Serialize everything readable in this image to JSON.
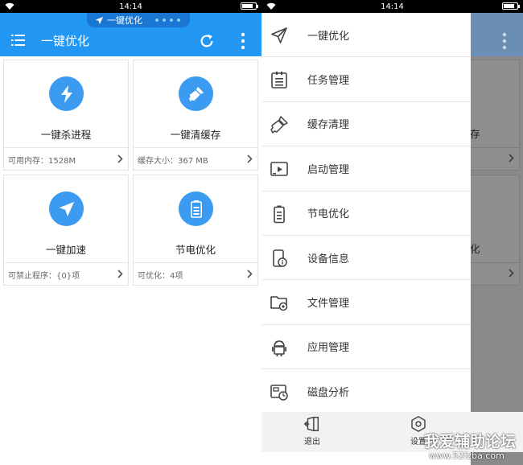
{
  "left": {
    "status_time": "14:14",
    "tip_text": "一键优化",
    "app_title": "一键优化",
    "cards": [
      {
        "name": "一键杀进程",
        "foot": "可用内存：1528M",
        "icon": "lightning-icon"
      },
      {
        "name": "一键清缓存",
        "foot": "缓存大小：367 MB",
        "icon": "broom-icon"
      },
      {
        "name": "一键加速",
        "foot": "可禁止程序：{0}项",
        "icon": "paper-plane-icon"
      },
      {
        "name": "节电优化",
        "foot": "可优化：4项",
        "icon": "battery-icon"
      }
    ]
  },
  "right": {
    "status_time": "14:14",
    "bg_fragments": [
      "存",
      "化"
    ],
    "drawer_items": [
      {
        "label": "一键优化",
        "icon": "paper-plane-icon"
      },
      {
        "label": "任务管理",
        "icon": "clipboard-icon"
      },
      {
        "label": "缓存清理",
        "icon": "broom-icon"
      },
      {
        "label": "启动管理",
        "icon": "launch-icon"
      },
      {
        "label": "节电优化",
        "icon": "battery-icon"
      },
      {
        "label": "设备信息",
        "icon": "phone-info-icon"
      },
      {
        "label": "文件管理",
        "icon": "folder-gear-icon"
      },
      {
        "label": "应用管理",
        "icon": "android-icon"
      },
      {
        "label": "磁盘分析",
        "icon": "disk-icon"
      }
    ],
    "exit_label": "退出",
    "settings_label": "设置"
  },
  "watermark": {
    "line1": "我爱辅助论坛",
    "line2": "www.52fzba.com"
  },
  "colors": {
    "primary": "#2196f3",
    "icon_circle": "#3a9bf0"
  }
}
